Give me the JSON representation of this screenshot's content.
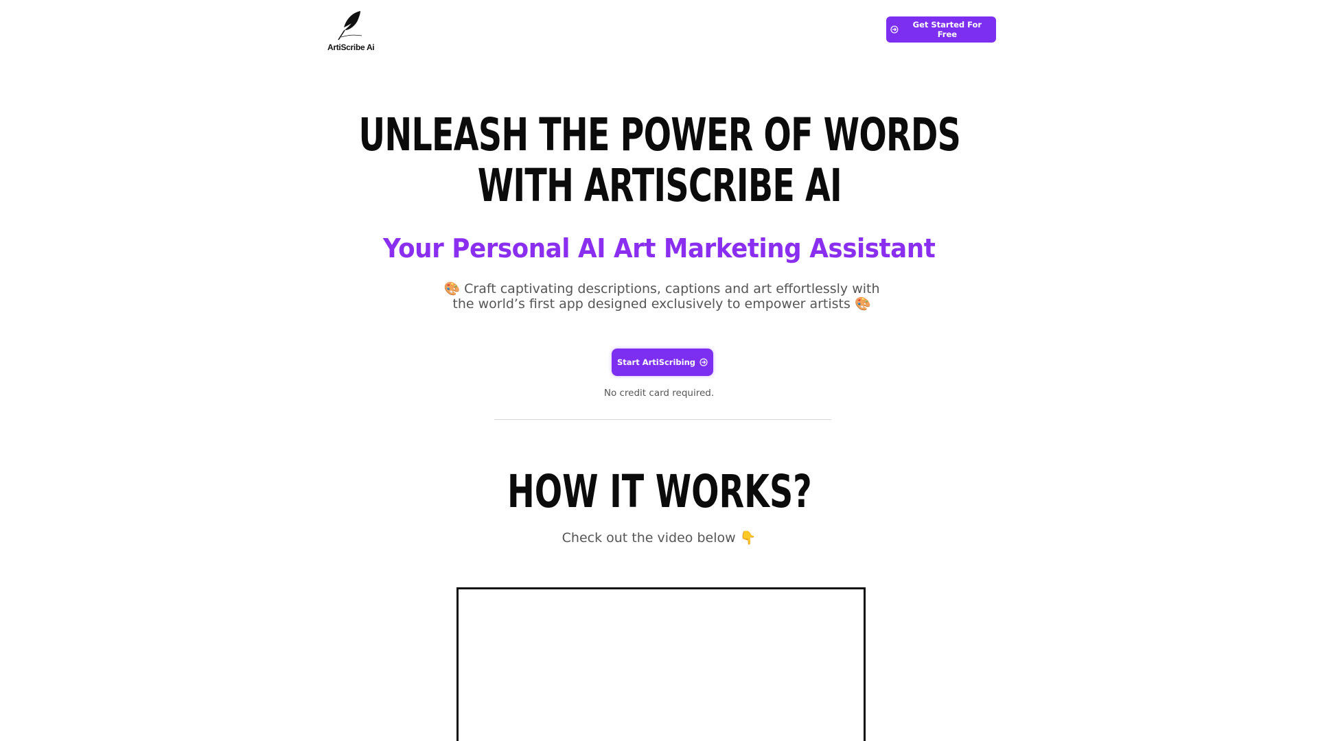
{
  "header": {
    "logo_text": "ArtiScribe Ai",
    "cta_label": "Get Started For Free"
  },
  "hero": {
    "title_line1": "UNLEASH THE POWER OF WORDS",
    "title_line2": "WITH ARTISCRIBE AI",
    "subtitle": "Your Personal AI Art Marketing Assistant",
    "desc_line1": "🎨 Craft captivating descriptions, captions and art effortlessly with",
    "desc_line2": "the world’s first app designed exclusively to empower artists 🎨",
    "cta_label": "Start ArtiScribing",
    "note": "No credit card required."
  },
  "how": {
    "title": "HOW IT WORKS?",
    "subtitle": "Check out the video below 👇"
  },
  "colors": {
    "accent": "#7c2ff0",
    "subtitle": "#8a2ff0",
    "text_muted": "#555555"
  },
  "icons": {
    "logo": "quill-feather-icon",
    "cta": "arrow-circle-icon"
  }
}
